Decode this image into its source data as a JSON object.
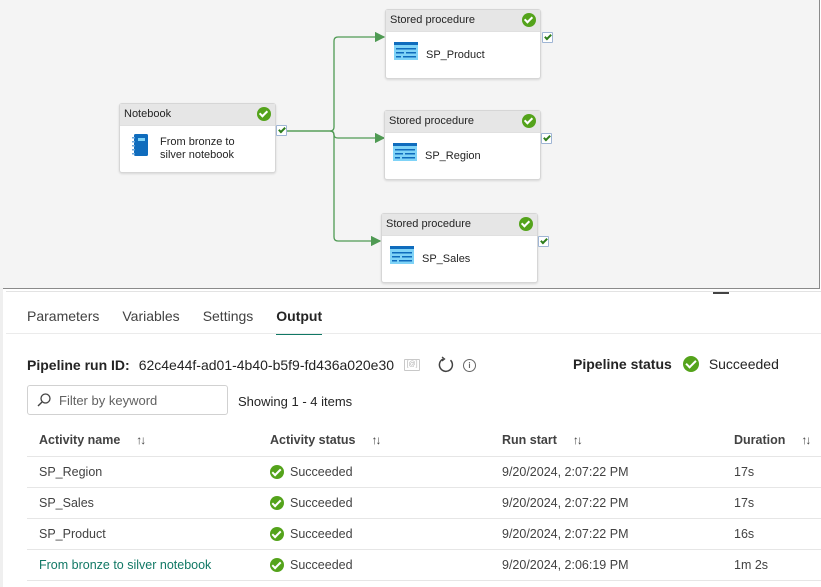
{
  "canvas": {
    "nodes": [
      {
        "id": "notebook",
        "type": "Notebook",
        "name": "From bronze to silver notebook",
        "name_lines": [
          "From bronze to",
          "silver notebook"
        ],
        "icon": "notebook-icon",
        "status": "succeeded"
      },
      {
        "id": "sp_product",
        "type": "Stored procedure",
        "name": "SP_Product",
        "icon": "stored-procedure-icon",
        "status": "succeeded"
      },
      {
        "id": "sp_region",
        "type": "Stored procedure",
        "name": "SP_Region",
        "icon": "stored-procedure-icon",
        "status": "succeeded"
      },
      {
        "id": "sp_sales",
        "type": "Stored procedure",
        "name": "SP_Sales",
        "icon": "stored-procedure-icon",
        "status": "succeeded"
      }
    ],
    "connections": [
      {
        "from": "notebook",
        "to": "sp_product",
        "condition": "on-success"
      },
      {
        "from": "notebook",
        "to": "sp_region",
        "condition": "on-success"
      },
      {
        "from": "notebook",
        "to": "sp_sales",
        "condition": "on-success"
      }
    ]
  },
  "tabs": [
    {
      "label": "Parameters",
      "active": false
    },
    {
      "label": "Variables",
      "active": false
    },
    {
      "label": "Settings",
      "active": false
    },
    {
      "label": "Output",
      "active": true
    }
  ],
  "output": {
    "run_id_label": "Pipeline run ID:",
    "run_id": "62c4e44f-ad01-4b40-b5f9-fd436a020e30",
    "status_label": "Pipeline status",
    "status": "Succeeded",
    "search_placeholder": "Filter by keyword",
    "search_value": "",
    "showing": "Showing 1 - 4 items",
    "columns": [
      "Activity name",
      "Activity status",
      "Run start",
      "Duration"
    ],
    "rows": [
      {
        "name": "SP_Region",
        "status": "Succeeded",
        "run_start": "9/20/2024, 2:07:22 PM",
        "duration": "17s",
        "is_link": false
      },
      {
        "name": "SP_Sales",
        "status": "Succeeded",
        "run_start": "9/20/2024, 2:07:22 PM",
        "duration": "17s",
        "is_link": false
      },
      {
        "name": "SP_Product",
        "status": "Succeeded",
        "run_start": "9/20/2024, 2:07:22 PM",
        "duration": "16s",
        "is_link": false
      },
      {
        "name": "From bronze to silver notebook",
        "status": "Succeeded",
        "run_start": "9/20/2024, 2:06:19 PM",
        "duration": "1m 2s",
        "is_link": true
      }
    ]
  },
  "colors": {
    "success": "#54a31b",
    "accent": "#117865",
    "connector": "#4f9a53"
  }
}
